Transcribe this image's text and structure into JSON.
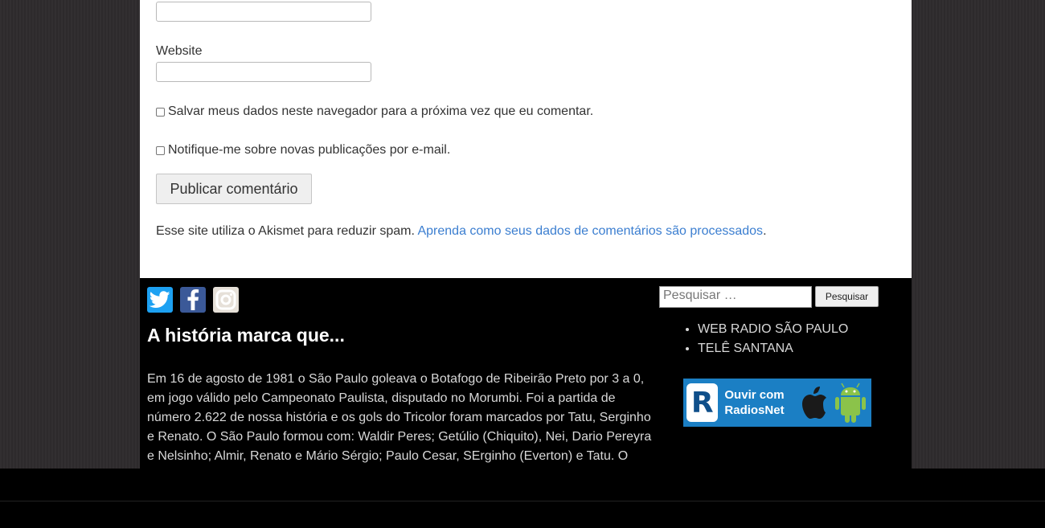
{
  "form": {
    "website_label": "Website",
    "save_data_label": "Salvar meus dados neste navegador para a próxima vez que eu comentar.",
    "notify_label": "Notifique-me sobre novas publicações por e-mail.",
    "submit_label": "Publicar comentário",
    "akismet_text": "Esse site utiliza o Akismet para reduzir spam.",
    "akismet_link": "Aprenda como seus dados de comentários são processados",
    "akismet_period": "."
  },
  "footer": {
    "social": [
      "twitter-icon",
      "facebook-icon",
      "instagram-icon"
    ],
    "widget_title": "A história marca que...",
    "story": "Em 16 de agosto de 1981 o São Paulo goleava o Botafogo de Ribeirão Preto por 3 a 0, em jogo válido pelo Campeonato Paulista, disputado no Morumbi. Foi a partida de número 2.622 de nossa história e os gols do Tricolor foram marcados por Tatu, Serginho e Renato. O São Paulo formou com: Waldir Peres; Getúlio (Chiquito), Nei, Dario Pereyra e Nelsinho; Almir, Renato e Mário Sérgio; Paulo Cesar, SErginho (Everton) e Tatu. O técnico",
    "search_placeholder": "Pesquisar …",
    "search_button": "Pesquisar",
    "links": [
      "WEB RADIO SÃO PAULO",
      "TELÊ SANTANA"
    ],
    "badge": {
      "letter": "R",
      "line1": "Ouvir com",
      "line2": "RadiosNet"
    }
  },
  "colors": {
    "link": "#3b7ed0",
    "twitter": "#1da1f2",
    "facebook": "#3b5998",
    "badge": "#1b7fc4"
  }
}
